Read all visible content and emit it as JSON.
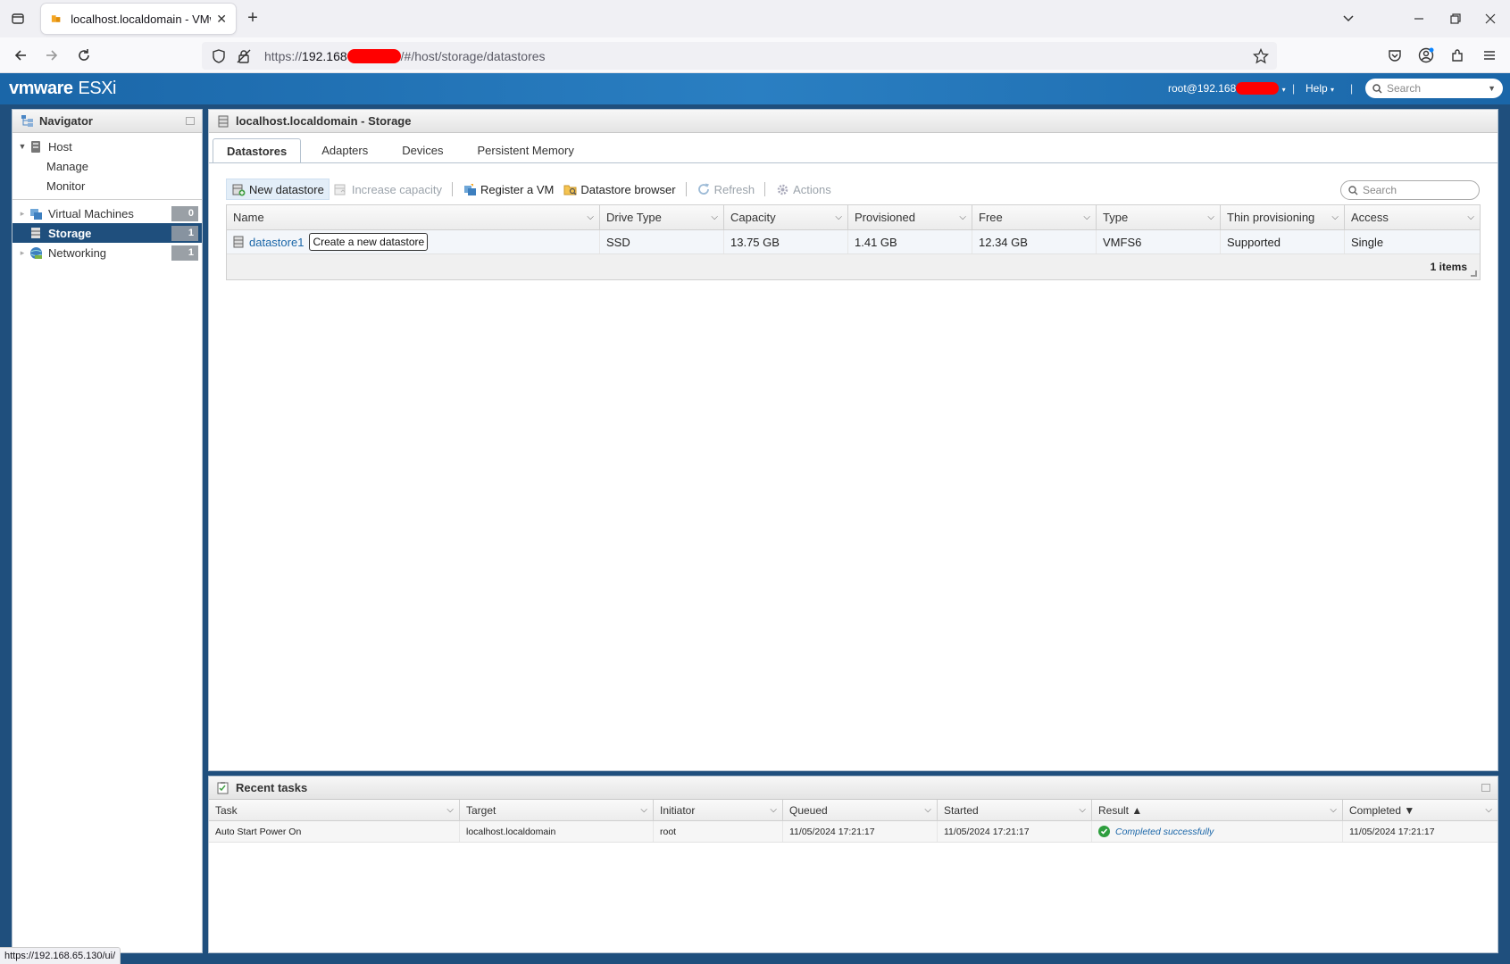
{
  "browser": {
    "tab_title": "localhost.localdomain - VMware",
    "url_prefix": "https://",
    "url_host": "192.168",
    "url_path": "/#/host/storage/datastores",
    "status_url": "https://192.168.65.130/ui/"
  },
  "header": {
    "logo_brand": "vmware",
    "logo_product": "ESXi",
    "user": "root@192.168",
    "help": "Help",
    "search_placeholder": "Search"
  },
  "navigator": {
    "title": "Navigator",
    "host": "Host",
    "manage": "Manage",
    "monitor": "Monitor",
    "items": [
      {
        "label": "Virtual Machines",
        "count": "0"
      },
      {
        "label": "Storage",
        "count": "1"
      },
      {
        "label": "Networking",
        "count": "1"
      }
    ]
  },
  "content": {
    "title": "localhost.localdomain - Storage",
    "tabs": [
      "Datastores",
      "Adapters",
      "Devices",
      "Persistent Memory"
    ],
    "toolbar": {
      "new_datastore": "New datastore",
      "increase_capacity": "Increase capacity",
      "register_vm": "Register a VM",
      "datastore_browser": "Datastore browser",
      "refresh": "Refresh",
      "actions": "Actions"
    },
    "search_placeholder": "Search",
    "columns": [
      "Name",
      "Drive Type",
      "Capacity",
      "Provisioned",
      "Free",
      "Type",
      "Thin provisioning",
      "Access"
    ],
    "rows": [
      {
        "name": "datastore1",
        "drive_type": "SSD",
        "capacity": "13.75 GB",
        "provisioned": "1.41 GB",
        "free": "12.34 GB",
        "type": "VMFS6",
        "thin": "Supported",
        "access": "Single"
      }
    ],
    "tooltip": "Create a new datastore",
    "footer": "1 items"
  },
  "tasks": {
    "title": "Recent tasks",
    "columns": [
      "Task",
      "Target",
      "Initiator",
      "Queued",
      "Started",
      "Result ▲",
      "Completed ▼"
    ],
    "rows": [
      {
        "task": "Auto Start Power On",
        "target": "localhost.localdomain",
        "initiator": "root",
        "queued": "11/05/2024 17:21:17",
        "started": "11/05/2024 17:21:17",
        "result": "Completed successfully",
        "completed": "11/05/2024 17:21:17"
      }
    ]
  },
  "colors": {
    "brand_blue": "#1a66a8",
    "nav_selected": "#1f4f7d",
    "success": "#2e9e3e"
  }
}
